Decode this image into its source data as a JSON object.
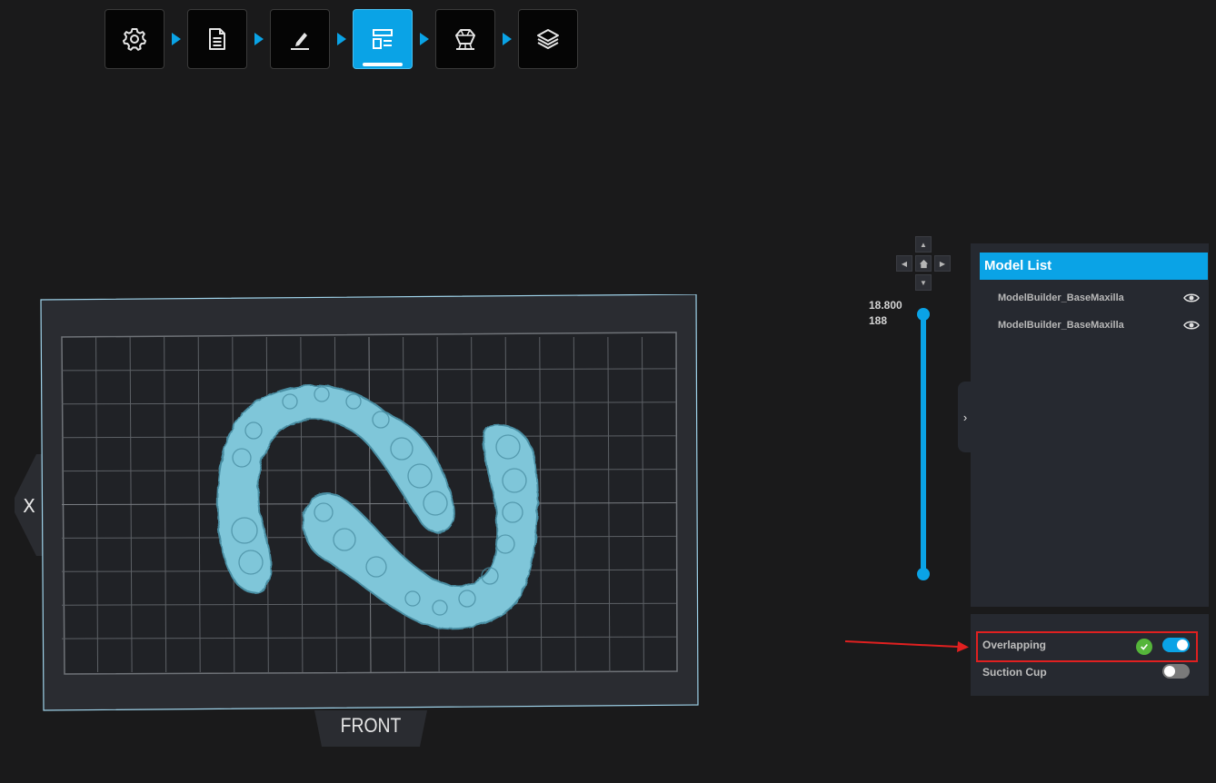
{
  "toolbar": {
    "steps": [
      {
        "name": "settings",
        "icon": "gear-icon",
        "active": false
      },
      {
        "name": "document",
        "icon": "document-icon",
        "active": false
      },
      {
        "name": "edit",
        "icon": "pen-icon",
        "active": false
      },
      {
        "name": "layout",
        "icon": "layout-icon",
        "active": true
      },
      {
        "name": "support",
        "icon": "support-structure-icon",
        "active": false
      },
      {
        "name": "slice",
        "icon": "layers-icon",
        "active": false
      }
    ]
  },
  "viewport": {
    "side_label": "X",
    "front_label": "FRONT",
    "model_color": "#7ec4d6"
  },
  "slider": {
    "value_top": "18.800",
    "value_bottom": "188",
    "accent": "#0aa3e6"
  },
  "model_list": {
    "title": "Model List",
    "items": [
      {
        "name": "ModelBuilder_BaseMaxilla",
        "visible": true
      },
      {
        "name": "ModelBuilder_BaseMaxilla",
        "visible": true
      }
    ]
  },
  "options": {
    "overlapping": {
      "label": "Overlapping",
      "enabled": true,
      "status": "ok"
    },
    "suction_cup": {
      "label": "Suction Cup",
      "enabled": false
    }
  },
  "colors": {
    "accent": "#0aa3e6",
    "panel": "#262930",
    "background": "#1a1a1b",
    "annotation": "#e02020"
  }
}
